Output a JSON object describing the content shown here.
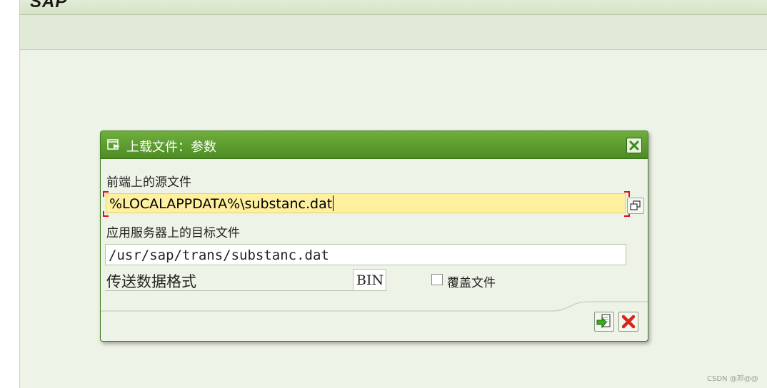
{
  "app": {
    "logo_text": "SAP"
  },
  "dialog": {
    "title": "上载文件：参数",
    "source_label": "前端上的源文件",
    "source_value": "%LOCALAPPDATA%\\substanc.dat",
    "target_label": "应用服务器上的目标文件",
    "target_value": "/usr/sap/trans/substanc.dat",
    "format_label": "传送数据格式",
    "format_value": "BIN",
    "overwrite_label": "覆盖文件",
    "overwrite_checked": false
  },
  "watermark": "CSDN @邓@@",
  "colors": {
    "dialog_header": "#5a9a2e",
    "input_required_bg": "#fff0a0",
    "cancel_red": "#d9261c"
  }
}
